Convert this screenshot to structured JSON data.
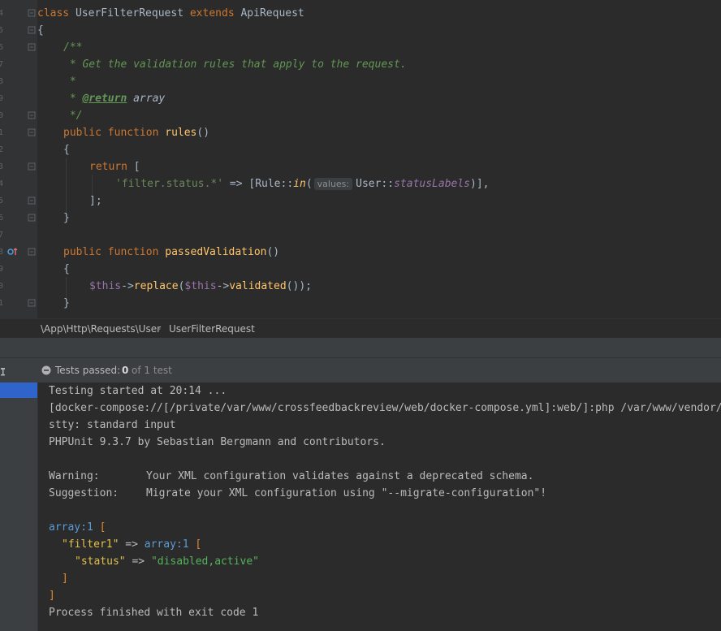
{
  "editor": {
    "line_numbers": [
      "4",
      "5",
      "6",
      "7",
      "8",
      "9",
      "0",
      "1",
      "2",
      "3",
      "4",
      "5",
      "6",
      "7",
      "8",
      "9",
      "0",
      "1"
    ],
    "class_keyword": "class",
    "class_name": "UserFilterRequest",
    "extends_keyword": "extends",
    "parent_class": "ApiRequest",
    "open_brace": "{",
    "doc_open": "/**",
    "doc_line1": " * Get the validation rules that apply to the request.",
    "doc_line2": " *",
    "doc_star": " * ",
    "doc_return_tag": "@return",
    "doc_return_type": " array",
    "doc_close": " */",
    "rules_public": "public",
    "rules_function": "function",
    "rules_name": "rules",
    "rules_parens": "()",
    "rules_open": "{",
    "return_kw": "return",
    "return_bracket": " [",
    "array_key": "'filter.status.*'",
    "arrow": " => [Rule::",
    "in_fn": "in",
    "paren_open": "(",
    "param_hint": "values:",
    "user_class": "User::",
    "status_labels": "statusLabels",
    "close_expr": ")],",
    "array_close": "];",
    "rules_close": "}",
    "passed_public": "public",
    "passed_function": "function",
    "passed_name": "passedValidation",
    "passed_parens": "()",
    "passed_open": "{",
    "this1": "$this",
    "arrow_op": "->",
    "replace_fn": "replace",
    "paren2": "(",
    "this2": "$this",
    "arrow_op2": "->",
    "validated_fn": "validated",
    "call_end": "());",
    "passed_close": "}"
  },
  "breadcrumb": {
    "namespace": "\\App\\Http\\Requests\\User",
    "separator": "›",
    "class": "UserFilterRequest"
  },
  "run_panel": {
    "status_icon": "minus-circle-icon",
    "tests_label": "Tests passed:",
    "passed_count": "0",
    "total_text": "of 1 test"
  },
  "console": {
    "line1": "Testing started at 20:14 ...",
    "line2": "[docker-compose://[/private/var/www/crossfeedbackreview/web/docker-compose.yml]:web/]:php /var/www/vendor/",
    "line3": "stty: standard input",
    "line4": "PHPUnit 9.3.7 by Sebastian Bergmann and contributors.",
    "warning_label": "Warning:",
    "warning_text": "Your XML configuration validates against a deprecated schema.",
    "suggestion_label": "Suggestion:",
    "suggestion_text": "Migrate your XML configuration using \"--migrate-configuration\"!",
    "dump_type1": "array:1",
    "dump_open1": " [",
    "dump_key1": "\"filter1\"",
    "dump_arrow1": " => ",
    "dump_type2": "array:1",
    "dump_open2": " [",
    "dump_key2": "\"status\"",
    "dump_arrow2": " => ",
    "dump_val": "\"disabled,active\"",
    "dump_close2": "]",
    "dump_close1": "]",
    "finish": "Process finished with exit code 1"
  },
  "colors": {
    "editor_bg": "#2b2b2b",
    "keyword": "#cc7832",
    "function": "#ffc66d",
    "comment": "#629755",
    "string": "#6a8759",
    "variable": "#9876aa",
    "selection": "#2f65ca"
  }
}
